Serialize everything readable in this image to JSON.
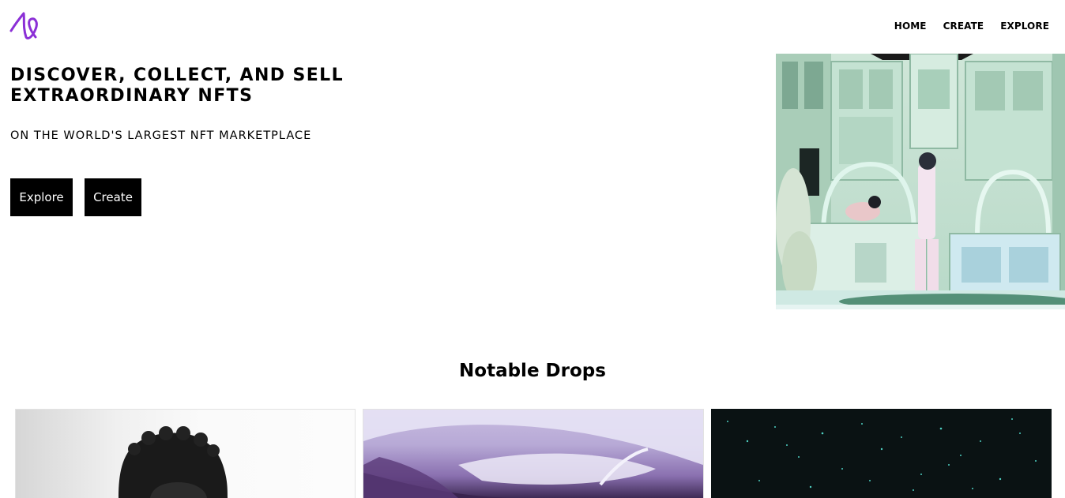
{
  "header": {
    "logo_icon": "purple-scribble-logo",
    "nav": [
      {
        "label": "HOME"
      },
      {
        "label": "CREATE"
      },
      {
        "label": "EXPLORE"
      }
    ]
  },
  "hero": {
    "title": "DISCOVER, COLLECT, AND SELL EXTRAORDINARY NFTS",
    "subtitle": "ON THE WORLD'S LARGEST NFT MARKETPLACE",
    "explore_label": "Explore",
    "create_label": "Create"
  },
  "notable": {
    "title": "Notable Drops"
  },
  "colors": {
    "accent": "#8b2fd6",
    "button_bg": "#000000",
    "button_text": "#ffffff"
  }
}
